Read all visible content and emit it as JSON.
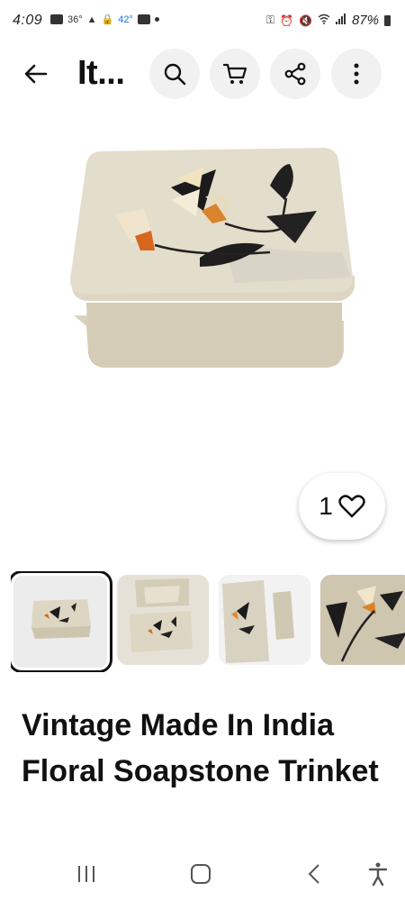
{
  "status_bar": {
    "time": "4:09",
    "network": "36°",
    "temperature": "42°",
    "battery": "87%"
  },
  "app_bar": {
    "title": "It..."
  },
  "hero": {
    "like_count": "1"
  },
  "thumbnails": [
    {
      "selected": true
    },
    {
      "selected": false
    },
    {
      "selected": false
    },
    {
      "selected": false
    }
  ],
  "product": {
    "title": "Vintage Made In India Floral Soapstone Trinket"
  },
  "icons": {
    "back": "back-arrow-icon",
    "search": "search-icon",
    "cart": "cart-icon",
    "share": "share-icon",
    "more": "more-vertical-icon",
    "like": "heart-icon"
  }
}
